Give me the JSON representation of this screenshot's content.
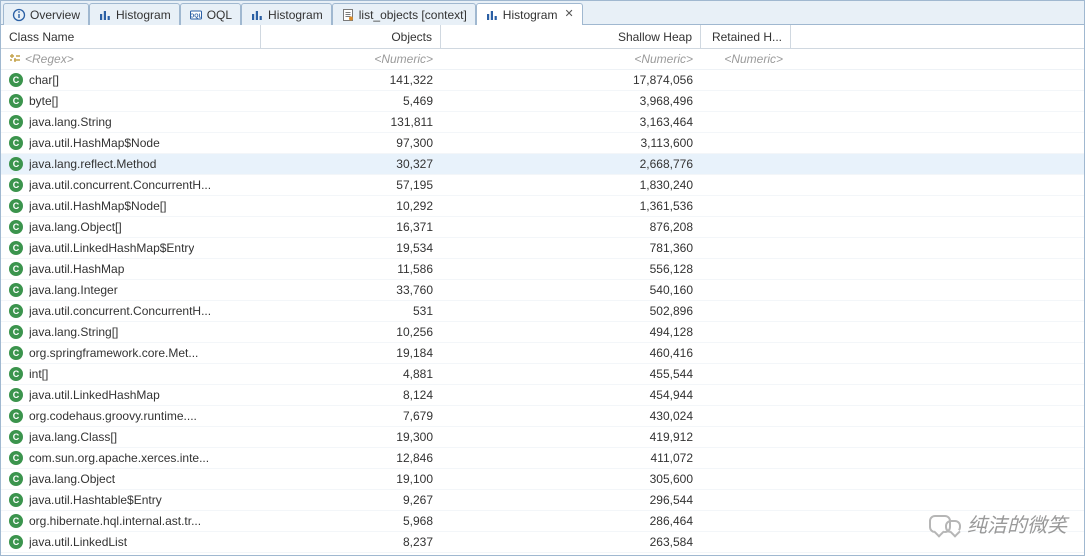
{
  "tabs": [
    {
      "label": "Overview",
      "icon": "info"
    },
    {
      "label": "Histogram",
      "icon": "bars"
    },
    {
      "label": "OQL",
      "icon": "oql"
    },
    {
      "label": "Histogram",
      "icon": "bars"
    },
    {
      "label": "list_objects [context]",
      "icon": "sheet"
    },
    {
      "label": "Histogram",
      "icon": "bars",
      "active": true,
      "closable": true
    }
  ],
  "columns": {
    "class": "Class Name",
    "objects": "Objects",
    "shallow": "Shallow Heap",
    "retained": "Retained H..."
  },
  "filters": {
    "class": "<Regex>",
    "objects": "<Numeric>",
    "shallow": "<Numeric>",
    "retained": "<Numeric>"
  },
  "selected_index": 4,
  "rows": [
    {
      "name": "char[]",
      "objects": "141,322",
      "shallow": "17,874,056"
    },
    {
      "name": "byte[]",
      "objects": "5,469",
      "shallow": "3,968,496"
    },
    {
      "name": "java.lang.String",
      "objects": "131,811",
      "shallow": "3,163,464"
    },
    {
      "name": "java.util.HashMap$Node",
      "objects": "97,300",
      "shallow": "3,113,600"
    },
    {
      "name": "java.lang.reflect.Method",
      "objects": "30,327",
      "shallow": "2,668,776"
    },
    {
      "name": "java.util.concurrent.ConcurrentH...",
      "objects": "57,195",
      "shallow": "1,830,240"
    },
    {
      "name": "java.util.HashMap$Node[]",
      "objects": "10,292",
      "shallow": "1,361,536"
    },
    {
      "name": "java.lang.Object[]",
      "objects": "16,371",
      "shallow": "876,208"
    },
    {
      "name": "java.util.LinkedHashMap$Entry",
      "objects": "19,534",
      "shallow": "781,360"
    },
    {
      "name": "java.util.HashMap",
      "objects": "11,586",
      "shallow": "556,128"
    },
    {
      "name": "java.lang.Integer",
      "objects": "33,760",
      "shallow": "540,160"
    },
    {
      "name": "java.util.concurrent.ConcurrentH...",
      "objects": "531",
      "shallow": "502,896"
    },
    {
      "name": "java.lang.String[]",
      "objects": "10,256",
      "shallow": "494,128"
    },
    {
      "name": "org.springframework.core.Met...",
      "objects": "19,184",
      "shallow": "460,416"
    },
    {
      "name": "int[]",
      "objects": "4,881",
      "shallow": "455,544"
    },
    {
      "name": "java.util.LinkedHashMap",
      "objects": "8,124",
      "shallow": "454,944"
    },
    {
      "name": "org.codehaus.groovy.runtime....",
      "objects": "7,679",
      "shallow": "430,024"
    },
    {
      "name": "java.lang.Class[]",
      "objects": "19,300",
      "shallow": "419,912"
    },
    {
      "name": "com.sun.org.apache.xerces.inte...",
      "objects": "12,846",
      "shallow": "411,072"
    },
    {
      "name": "java.lang.Object",
      "objects": "19,100",
      "shallow": "305,600"
    },
    {
      "name": "java.util.Hashtable$Entry",
      "objects": "9,267",
      "shallow": "296,544"
    },
    {
      "name": "org.hibernate.hql.internal.ast.tr...",
      "objects": "5,968",
      "shallow": "286,464"
    },
    {
      "name": "java.util.LinkedList",
      "objects": "8,237",
      "shallow": "263,584"
    }
  ],
  "watermark": "纯洁的微笑"
}
